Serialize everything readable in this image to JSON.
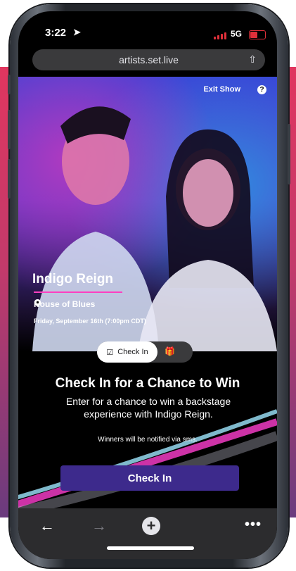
{
  "status": {
    "time": "3:22",
    "network": "5G"
  },
  "browser": {
    "url": "artists.set.live"
  },
  "hero": {
    "exit_label": "Exit Show",
    "help_label": "?",
    "band": "Indigo Reign",
    "venue": "House of Blues",
    "date": "Friday, September 16th (7:00pm CDT)"
  },
  "tabs": {
    "checkin_label": "Check In"
  },
  "promo": {
    "heading": "Check In for a Chance to Win",
    "subtext": "Enter for a chance to win a backstage experience with Indigo Reign.",
    "note": "Winners will be notified via sms.",
    "button_label": "Check In"
  },
  "colors": {
    "accent": "#3d2a8c",
    "pink": "#ff40c0",
    "status_red": "#e0303a"
  }
}
